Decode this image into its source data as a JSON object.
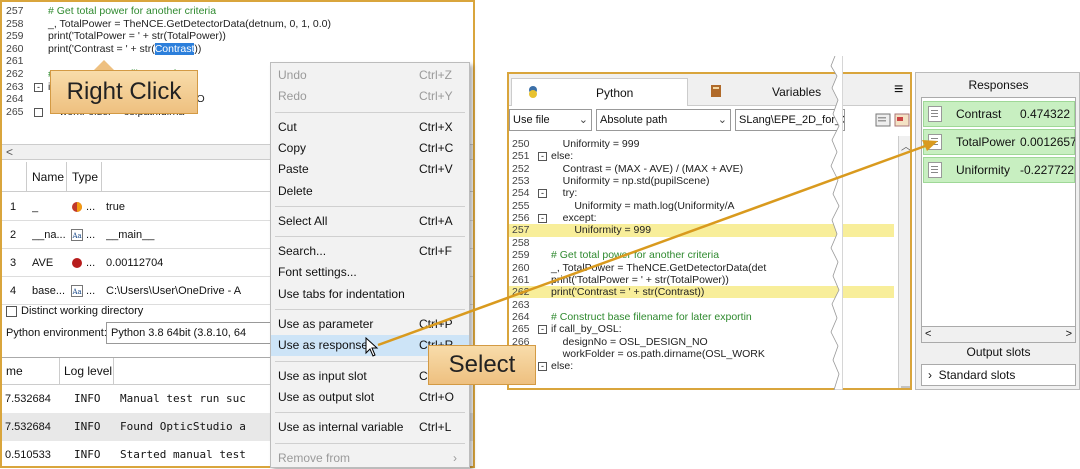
{
  "left_code": [
    {
      "n": "257",
      "t": "# Get total power for another criteria",
      "c": true
    },
    {
      "n": "258",
      "t": "_, TotalPower = TheNCE.GetDetectorData(detnum, 0, 1, 0.0)"
    },
    {
      "n": "259",
      "t": "print('TotalPower = ' + str(TotalPower))"
    },
    {
      "n": "260",
      "t_pre": "print('Contrast = ' + str(",
      "t_sel": "Contrast",
      "t_post": "))"
    },
    {
      "n": "261",
      "t": ""
    },
    {
      "n": "262",
      "t": "# Construct base filename for",
      "c": true
    },
    {
      "n": "263",
      "t": "if call_by_OSL:"
    },
    {
      "n": "264",
      "t": "    designNo = OSL_DESIGN_NO"
    },
    {
      "n": "265",
      "t": "    workFolder = os.path.dirna"
    }
  ],
  "var_table": {
    "headers": [
      "Name",
      "Type"
    ],
    "rows": [
      {
        "idx": "1",
        "name": "_",
        "type": "...",
        "value": "true"
      },
      {
        "idx": "2",
        "name": "__na...",
        "type": "...",
        "value": "__main__"
      },
      {
        "idx": "3",
        "name": "AVE",
        "type": "...",
        "value": "0.00112704"
      },
      {
        "idx": "4",
        "name": "base...",
        "type": "...",
        "value": "C:\\Users\\User\\OneDrive - A"
      }
    ]
  },
  "distinct_wd": "Distinct working directory",
  "python_env_label": "Python environment:",
  "python_env_value": "Python 3.8 64bit (3.8.10, 64",
  "log_table": {
    "headers": [
      "me",
      "Log level"
    ],
    "rows": [
      {
        "time": "7.532684",
        "level": "INFO",
        "msg": "Manual test run suc"
      },
      {
        "time": "7.532684",
        "level": "INFO",
        "msg": "Found OpticStudio a"
      },
      {
        "time": "0.510533",
        "level": "INFO",
        "msg": "Started manual test"
      }
    ]
  },
  "callouts": {
    "right_click": "Right Click",
    "select": "Select"
  },
  "context_menu": [
    {
      "label": "Undo",
      "shortcut": "Ctrl+Z",
      "disabled": true
    },
    {
      "label": "Redo",
      "shortcut": "Ctrl+Y",
      "disabled": true
    },
    {
      "sep": true
    },
    {
      "label": "Cut",
      "shortcut": "Ctrl+X"
    },
    {
      "label": "Copy",
      "shortcut": "Ctrl+C"
    },
    {
      "label": "Paste",
      "shortcut": "Ctrl+V"
    },
    {
      "label": "Delete",
      "shortcut": ""
    },
    {
      "sep": true
    },
    {
      "label": "Select All",
      "shortcut": "Ctrl+A"
    },
    {
      "sep": true
    },
    {
      "label": "Search...",
      "shortcut": "Ctrl+F"
    },
    {
      "label": "Font settings...",
      "shortcut": ""
    },
    {
      "label": "Use tabs for indentation",
      "shortcut": ""
    },
    {
      "sep": true
    },
    {
      "label": "Use as parameter",
      "shortcut": "Ctrl+P"
    },
    {
      "label": "Use as response",
      "shortcut": "Ctrl+R",
      "highlighted": true
    },
    {
      "sep": true
    },
    {
      "label": "Use as input slot",
      "shortcut": "Ctrl+I"
    },
    {
      "label": "Use as output slot",
      "shortcut": "Ctrl+O"
    },
    {
      "sep": true
    },
    {
      "label": "Use as internal variable",
      "shortcut": "Ctrl+L"
    },
    {
      "sep": true
    },
    {
      "label": "Remove from",
      "shortcut": "",
      "disabled": true,
      "submenu": true
    }
  ],
  "right_tabs": {
    "python": "Python",
    "variables": "Variables"
  },
  "toolbar": {
    "file_mode": "Use file",
    "path_mode": "Absolute path",
    "path_value": "SLang\\EPE_2D_for_C"
  },
  "right_code": [
    {
      "n": "250",
      "t": "    Uniformity = 999"
    },
    {
      "n": "251",
      "t": "else:",
      "f": "-"
    },
    {
      "n": "252",
      "t": "    Contrast = (MAX - AVE) / (MAX + AVE)"
    },
    {
      "n": "253",
      "t": "    Uniformity = np.std(pupilScene)"
    },
    {
      "n": "254",
      "t": "    try:",
      "f": "-"
    },
    {
      "n": "255",
      "t": "        Uniformity = math.log(Uniformity/A"
    },
    {
      "n": "256",
      "t": "    except:",
      "f": "-"
    },
    {
      "n": "257",
      "t": "        Uniformity = 999"
    },
    {
      "n": "258",
      "t": ""
    },
    {
      "n": "259",
      "t": "# Get total power for another criteria",
      "c": true
    },
    {
      "n": "260",
      "t": "_, TotalPower = TheNCE.GetDetectorData(det"
    },
    {
      "n": "261",
      "t": "print('TotalPower = ' + str(TotalPower))"
    },
    {
      "n": "262",
      "t": "print('Contrast = ' + str(Contrast))"
    },
    {
      "n": "263",
      "t": ""
    },
    {
      "n": "264",
      "t": "# Construct base filename for later exportin",
      "c": true
    },
    {
      "n": "265",
      "t": "if call_by_OSL:",
      "f": "-"
    },
    {
      "n": "266",
      "t": "    designNo = OSL_DESIGN_NO"
    },
    {
      "n": "267",
      "t": "    workFolder = os.path.dirname(OSL_WORK"
    },
    {
      "n": "268",
      "t": "else:",
      "f": "-"
    }
  ],
  "responses": {
    "title": "Responses",
    "items": [
      {
        "name": "Contrast",
        "value": "0.474322"
      },
      {
        "name": "TotalPower",
        "value": "0.0012657"
      },
      {
        "name": "Uniformity",
        "value": "-0.227722"
      }
    ],
    "output_slots_title": "Output slots",
    "standard_slots": "Standard slots"
  },
  "colors": {
    "accent_border": "#d9a53c",
    "response_bg": "#c8efc1",
    "arrow": "#d99a1e",
    "highlight": "#cde4f7",
    "selection": "#2c7fdb"
  }
}
